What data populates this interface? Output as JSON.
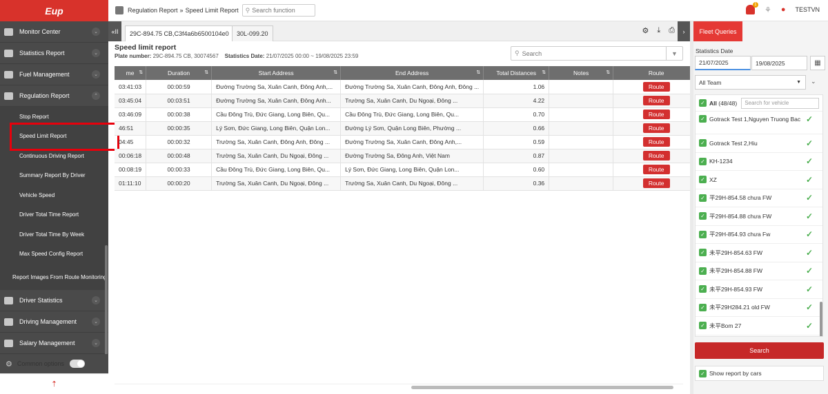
{
  "app": {
    "logo": "Eup",
    "user": "TESTVN",
    "notif_count": "1"
  },
  "breadcrumb": {
    "section": "Regulation Report",
    "sep": "»",
    "page": "Speed Limit Report"
  },
  "search_fn": {
    "placeholder": "Search function"
  },
  "sidebar": {
    "items": [
      {
        "label": "Monitor Center",
        "chev": "⌄"
      },
      {
        "label": "Statistics Report",
        "chev": "⌄"
      },
      {
        "label": "Fuel Management",
        "chev": "⌄"
      },
      {
        "label": "Regulation Report",
        "chev": "⌃"
      }
    ],
    "sub": [
      "Stop Report",
      "Speed Limit Report",
      "Continuous Driving Report",
      "Summary Report By Driver",
      "Vehicle Speed",
      "Driver Total Time Report",
      "Driver Total Time By Week",
      "Max Speed Config Report",
      "Report Images From Route Monitoring"
    ],
    "items2": [
      {
        "label": "Driver Statistics",
        "chev": "⌄"
      },
      {
        "label": "Driving Management",
        "chev": "⌄"
      },
      {
        "label": "Salary Management",
        "chev": "⌄"
      }
    ],
    "common": "Common options",
    "bottom_icon": "⇡"
  },
  "tabs": [
    "29C-894.75 CB,C3f4a6b6500104e0",
    "30L-099.20"
  ],
  "tab_collapse": "«II",
  "tab_expand": "›",
  "report": {
    "title": "Speed limit report",
    "plate_label": "Plate number:",
    "plate": "29C-894.75 CB, 30074567",
    "date_label": "Statistics Date:",
    "date": "21/07/2025 00:00 ~ 19/08/2025 23:59",
    "search_placeholder": "Search"
  },
  "table": {
    "headers": [
      "me",
      "Duration",
      "Start Address",
      "End Address",
      "Total Distances",
      "Notes",
      "Route"
    ],
    "sort": "⇅",
    "route_label": "Route",
    "rows": [
      {
        "time": "03:41:03",
        "dur": "00:00:59",
        "start": "Đường Trường Sa, Xuân Canh, Đông Anh,...",
        "end": "Đường Trường Sa, Xuân Canh, Đông Anh, Đông ...",
        "dist": "1.06"
      },
      {
        "time": "03:45:04",
        "dur": "00:03:51",
        "start": "Đường Trường Sa, Xuân Canh, Đông Anh...",
        "end": "Trường Sa, Xuân Canh, Du Ngoại, Đông ...",
        "dist": "4.22"
      },
      {
        "time": "03:46:09",
        "dur": "00:00:38",
        "start": "Cầu Đông Trù, Đức Giang, Long Biên, Qu...",
        "end": "Cầu Đông Trù, Đức Giang, Long Biên, Qu...",
        "dist": "0.70"
      },
      {
        "time": "46:51",
        "dur": "00:00:35",
        "start": "Lý Sơn, Đức Giang, Long Biên, Quận Lon...",
        "end": "Đường Lý Sơn, Quận Long Biên, Phường ...",
        "dist": "0.66"
      },
      {
        "time": "04:45",
        "dur": "00:00:32",
        "start": "Trường Sa, Xuân Canh, Đông Anh, Đông ...",
        "end": "Đường Trường Sa, Xuân Canh, Đông Anh,...",
        "dist": "0.59"
      },
      {
        "time": "00:06:18",
        "dur": "00:00:48",
        "start": "Trường Sa, Xuân Canh, Du Ngoại, Đông ...",
        "end": "Đường Trường Sa, Đông Anh, Việt Nam",
        "dist": "0.87"
      },
      {
        "time": "00:08:19",
        "dur": "00:00:33",
        "start": "Cầu Đông Trù, Đức Giang, Long Biên, Qu...",
        "end": "Lý Sơn, Đức Giang, Long Biên, Quận Lon...",
        "dist": "0.60"
      },
      {
        "time": "01:11:10",
        "dur": "00:00:20",
        "start": "Trường Sa, Xuân Canh, Du Ngoại, Đông ...",
        "end": "Trường Sa, Xuân Canh, Du Ngoại, Đông ...",
        "dist": "0.36"
      }
    ]
  },
  "queries": {
    "title": "Fleet Queries",
    "date_label": "Statistics Date",
    "from": "21/07/2025",
    "to": "19/08/2025",
    "team": "All Team",
    "all_label": "All",
    "all_count": "(48/48)",
    "vehicle_placeholder": "Search for vehicle",
    "vehicles": [
      "Gotrack Test 1,Nguyen Truong Bac",
      "Gotrack Test 2,Hiu",
      "KH-1234",
      "XZ",
      "平29H-854.58 chưa FW",
      "平29H-854.88 chưa FW",
      "平29H-854.93 chưa Fw",
      "未平29H-854.63 FW",
      "未平29H-854.88 FW",
      "未平29H-854.93 FW",
      "未平29H284.21 old FW",
      "未平Bom 27"
    ],
    "search_btn": "Search",
    "show_cars": "Show report by cars"
  },
  "colors": {
    "brand": "#d8322b",
    "sidebar": "#4a4a4a",
    "check": "#4caf50"
  }
}
